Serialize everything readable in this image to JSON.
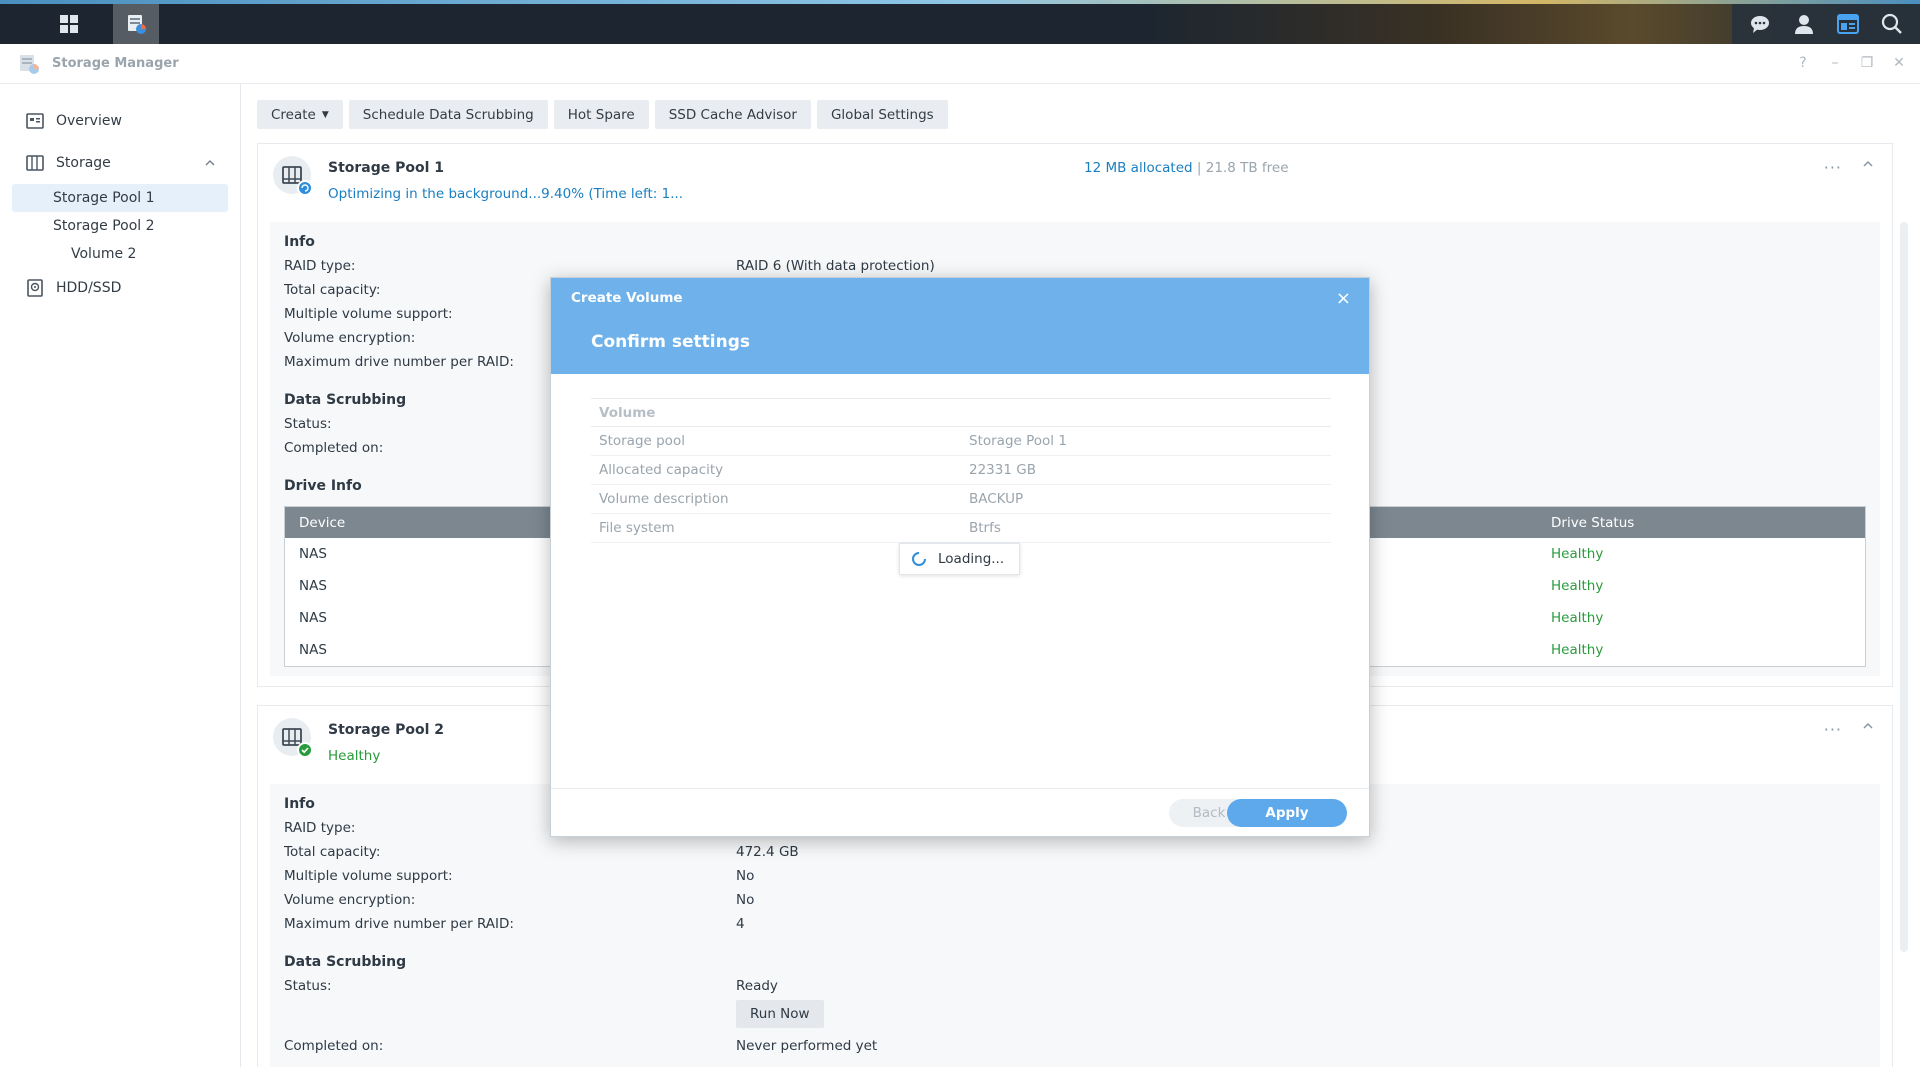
{
  "window": {
    "title": "Storage Manager"
  },
  "sidebar": {
    "items": [
      {
        "label": "Overview"
      },
      {
        "label": "Storage"
      },
      {
        "label": "Storage Pool 1"
      },
      {
        "label": "Storage Pool 2"
      },
      {
        "label": "Volume 2"
      },
      {
        "label": "HDD/SSD"
      }
    ]
  },
  "toolbar": {
    "create": "Create",
    "schedule": "Schedule Data Scrubbing",
    "hot_spare": "Hot Spare",
    "ssd_cache": "SSD Cache Advisor",
    "global": "Global Settings"
  },
  "pool1": {
    "name": "Storage Pool 1",
    "status": "Optimizing in the background...9.40% (Time left: 1...",
    "allocated": "12 MB allocated",
    "separator": "|",
    "free": "21.8 TB free",
    "more": "···",
    "info_title": "Info",
    "raid_type_label": "RAID type:",
    "raid_type_value": "RAID 6 (With data protection)",
    "total_capacity_label": "Total capacity:",
    "multi_volume_label": "Multiple volume support:",
    "encryption_label": "Volume encryption:",
    "max_drive_label": "Maximum drive number per RAID:",
    "scrub_title": "Data Scrubbing",
    "scrub_status_label": "Status:",
    "scrub_completed_label": "Completed on:",
    "drive_info_title": "Drive Info",
    "drive_table": {
      "headers": {
        "device": "Device",
        "status": "Drive Status"
      },
      "rows": [
        {
          "device": "NAS",
          "status": "Healthy"
        },
        {
          "device": "NAS",
          "status": "Healthy"
        },
        {
          "device": "NAS",
          "status": "Healthy"
        },
        {
          "device": "NAS",
          "status": "Healthy"
        }
      ]
    }
  },
  "pool2": {
    "name": "Storage Pool 2",
    "status": "Healthy",
    "more": "···",
    "info_title": "Info",
    "raid_type_label": "RAID type:",
    "total_capacity_label": "Total capacity:",
    "total_capacity_value": "472.4 GB",
    "multi_volume_label": "Multiple volume support:",
    "multi_volume_value": "No",
    "encryption_label": "Volume encryption:",
    "encryption_value": "No",
    "max_drive_label": "Maximum drive number per RAID:",
    "max_drive_value": "4",
    "scrub_title": "Data Scrubbing",
    "scrub_status_label": "Status:",
    "scrub_status_value": "Ready",
    "run_now": "Run Now",
    "scrub_completed_label": "Completed on:",
    "scrub_completed_value": "Never performed yet"
  },
  "dialog": {
    "title": "Create Volume",
    "close": "×",
    "subtitle": "Confirm settings",
    "section": "Volume",
    "rows": [
      {
        "key": "Storage pool",
        "value": "Storage Pool 1"
      },
      {
        "key": "Allocated capacity",
        "value": "22331 GB"
      },
      {
        "key": "Volume description",
        "value": "BACKUP"
      },
      {
        "key": "File system",
        "value": "Btrfs"
      }
    ],
    "loading": "Loading...",
    "back": "Back",
    "apply": "Apply"
  },
  "colors": {
    "accent": "#5ea9ec",
    "dialog_header": "#6fb1ea",
    "healthy": "#2a9b3d",
    "link": "#1a7fc1"
  }
}
